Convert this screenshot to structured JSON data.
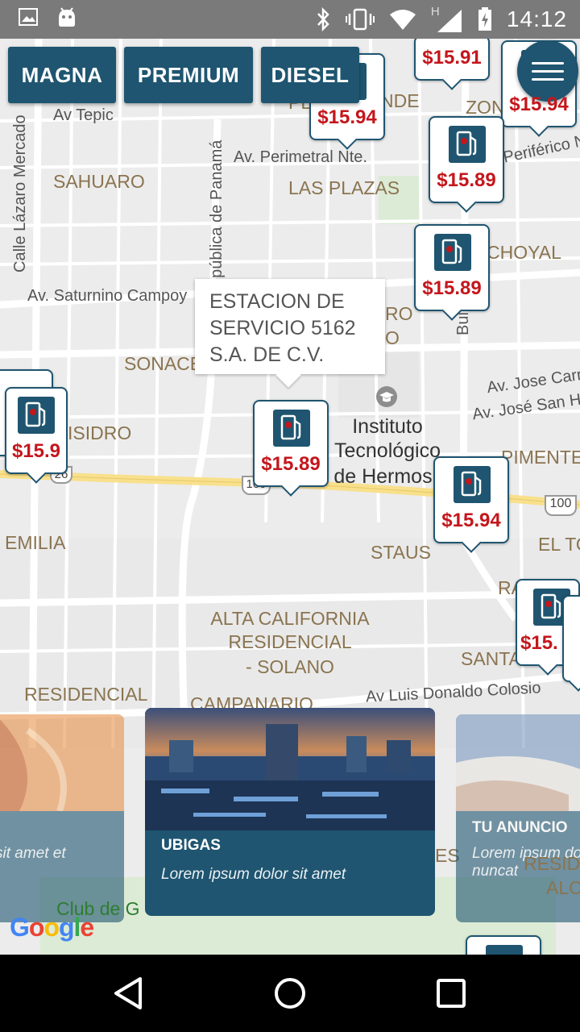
{
  "status_bar": {
    "time": "14:12",
    "icons": [
      "image-icon",
      "android-icon",
      "bluetooth-icon",
      "vibrate-icon",
      "wifi-icon",
      "signal-icon",
      "battery-charging-icon"
    ],
    "network_letter": "H"
  },
  "filters": {
    "magna": "MAGNA",
    "premium": "PREMIUM",
    "diesel": "DIESEL"
  },
  "menu": {
    "icon": "hamburger-menu-icon"
  },
  "map_labels": {
    "av_tepic": "Av Tepic",
    "calle_lazaro": "Calle Lázaro Mercado",
    "republica_panama": "epública de Panamá",
    "sahuaro": "SAHUARO",
    "av_perimetral": "Av. Perimetral Nte.",
    "las_plazas": "LAS PLAZAS",
    "periferico": "Periférico N",
    "choyal": "CHOYAL",
    "av_saturnino": "Av. Saturnino Campoy",
    "sonace": "SONACE",
    "ro": "RO",
    "o": "O",
    "bul": "Bul",
    "av_jose_carr": "Av. Jose Carr",
    "av_jose_san": "Av. José San H",
    "isidro": "ISIDRO",
    "instituto": "Instituto\nTecnológico\nde Hermosillo",
    "pimente": "PIMENTE",
    "emilia": "EMILIA",
    "staus": "STAUS",
    "el_to": "EL TO",
    "ra": "RA",
    "alta_california": "ALTA CALIFORNIA\nRESIDENCIAL\n- SOLANO",
    "santa": "SANTA",
    "residencial_rioja": "RESIDENCIAL\nLA RIOJA",
    "campanario": "CAMPANARIO",
    "av_luis_donaldo": "Av Luis Donaldo Colosio",
    "nde": "NDE",
    "zon": "ZON",
    "pla": "PLA",
    "club": "Club de G",
    "es": "ES",
    "resid": "RESIDE",
    "alc": "ALC",
    "road_26": "26",
    "road_100a": "100",
    "road_100b": "100"
  },
  "markers": [
    {
      "price": "$15.91"
    },
    {
      "price": "$15.94"
    },
    {
      "price": "$15.94"
    },
    {
      "price": "$15.89"
    },
    {
      "price": "$15.89"
    },
    {
      "price": "$15.9"
    },
    {
      "price": "$15.89"
    },
    {
      "price": "$15.94"
    },
    {
      "price": "$15."
    }
  ],
  "info_window": {
    "text": "ESTACION DE SERVICIO 5162 S.A. DE C.V."
  },
  "cards": [
    {
      "title": "",
      "text": "sit amet et"
    },
    {
      "title": "UBIGAS",
      "text": "Lorem ipsum dolor sit amet"
    },
    {
      "title": "TU ANUNCIO",
      "text": "Lorem ipsum do",
      "text2": "nuncat"
    }
  ],
  "google_logo": "Google",
  "colors": {
    "brand": "#1f5570",
    "price": "#c4161c",
    "map_bg": "#ececec"
  }
}
